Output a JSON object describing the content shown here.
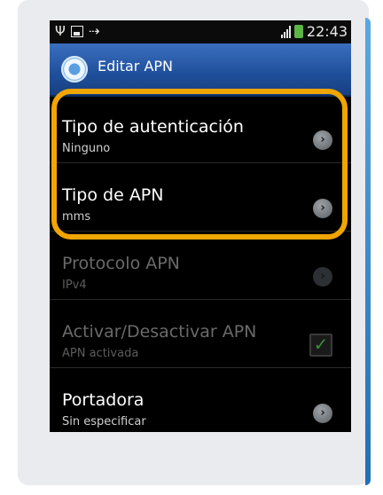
{
  "statusbar": {
    "time": "22:43",
    "icons": [
      "usb-icon",
      "image-icon",
      "sync-icon",
      "signal-icon",
      "battery-icon"
    ]
  },
  "titlebar": {
    "title": "Editar APN",
    "icon": "settings-gear-icon"
  },
  "settings": [
    {
      "label": "Tipo de autenticación",
      "value": "Ninguno",
      "enabled": true,
      "control": "arrow"
    },
    {
      "label": "Tipo de APN",
      "value": "mms",
      "enabled": true,
      "control": "arrow"
    },
    {
      "label": "Protocolo APN",
      "value": "IPv4",
      "enabled": false,
      "control": "arrow"
    },
    {
      "label": "Activar/Desactivar APN",
      "value": "APN activada",
      "enabled": false,
      "control": "checkbox",
      "checked": true
    },
    {
      "label": "Portadora",
      "value": "Sin especificar",
      "enabled": true,
      "control": "arrow"
    }
  ],
  "colors": {
    "highlight": "#f0a500",
    "titlebar": "#1f4f9a",
    "check": "#3d8a36"
  }
}
